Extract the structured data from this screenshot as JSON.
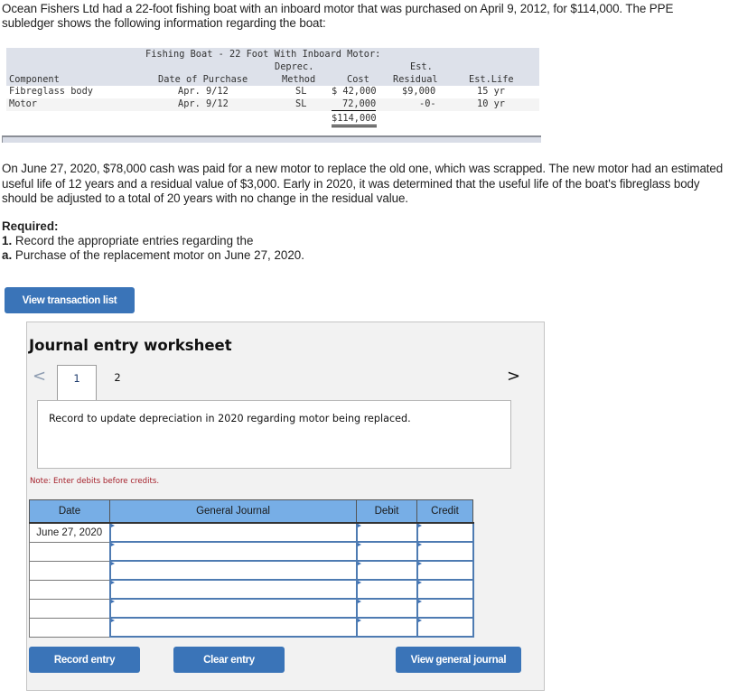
{
  "intro": "Ocean Fishers Ltd had a 22-foot fishing boat with an inboard motor that was purchased on April 9, 2012, for $114,000. The PPE subledger shows the following information regarding the boat:",
  "subledger": {
    "title": "Fishing Boat - 22 Foot With Inboard Motor:",
    "headers": {
      "component": "Component",
      "date": "Date of Purchase",
      "method_1": "Deprec.",
      "method_2": "Method",
      "cost": "Cost",
      "residual_1": "Est.",
      "residual_2": "Residual",
      "life": "Est.Life"
    },
    "rows": [
      {
        "component": "Fibreglass body",
        "date": "Apr. 9/12",
        "method": "SL",
        "cost": "$ 42,000",
        "residual": "$9,000",
        "life": "15 yr"
      },
      {
        "component": "Motor",
        "date": "Apr. 9/12",
        "method": "SL",
        "cost": "72,000",
        "residual": "-0-",
        "life": "10 yr"
      }
    ],
    "total_cost": "$114,000"
  },
  "paragraph": "On June 27, 2020, $78,000 cash was paid for a new motor to replace the old one, which was scrapped. The new motor had an estimated useful life of 12 years and a residual value of $3,000. Early in 2020, it was determined that the useful life of the boat's fibreglass body should be adjusted to a total of 20 years with no change in the residual value.",
  "required": {
    "label": "Required:",
    "item1_num": "1.",
    "item1_text": " Record the appropriate entries regarding the",
    "item_a_num": "a.",
    "item_a_text": " Purchase of the replacement motor on June 27, 2020."
  },
  "buttons": {
    "view_transaction_list": "View transaction list",
    "record_entry": "Record entry",
    "clear_entry": "Clear entry",
    "view_general_journal": "View general journal"
  },
  "worksheet": {
    "title": "Journal entry worksheet",
    "prev_icon": "<",
    "next_icon": ">",
    "tabs": [
      "1",
      "2"
    ],
    "active_tab": "1",
    "instruction": "Record to update depreciation in 2020 regarding motor being replaced.",
    "note": "Note: Enter debits before credits.",
    "columns": [
      "Date",
      "General Journal",
      "Debit",
      "Credit"
    ],
    "rows": [
      {
        "date": "June 27, 2020",
        "account": "",
        "debit": "",
        "credit": ""
      },
      {
        "date": "",
        "account": "",
        "debit": "",
        "credit": ""
      },
      {
        "date": "",
        "account": "",
        "debit": "",
        "credit": ""
      },
      {
        "date": "",
        "account": "",
        "debit": "",
        "credit": ""
      },
      {
        "date": "",
        "account": "",
        "debit": "",
        "credit": ""
      },
      {
        "date": "",
        "account": "",
        "debit": "",
        "credit": ""
      }
    ]
  },
  "colors": {
    "button_blue": "#3a74b8",
    "table_header_blue": "#77aee6",
    "note_red": "#a5202a",
    "ledger_header_bg": "#dde1ea"
  }
}
